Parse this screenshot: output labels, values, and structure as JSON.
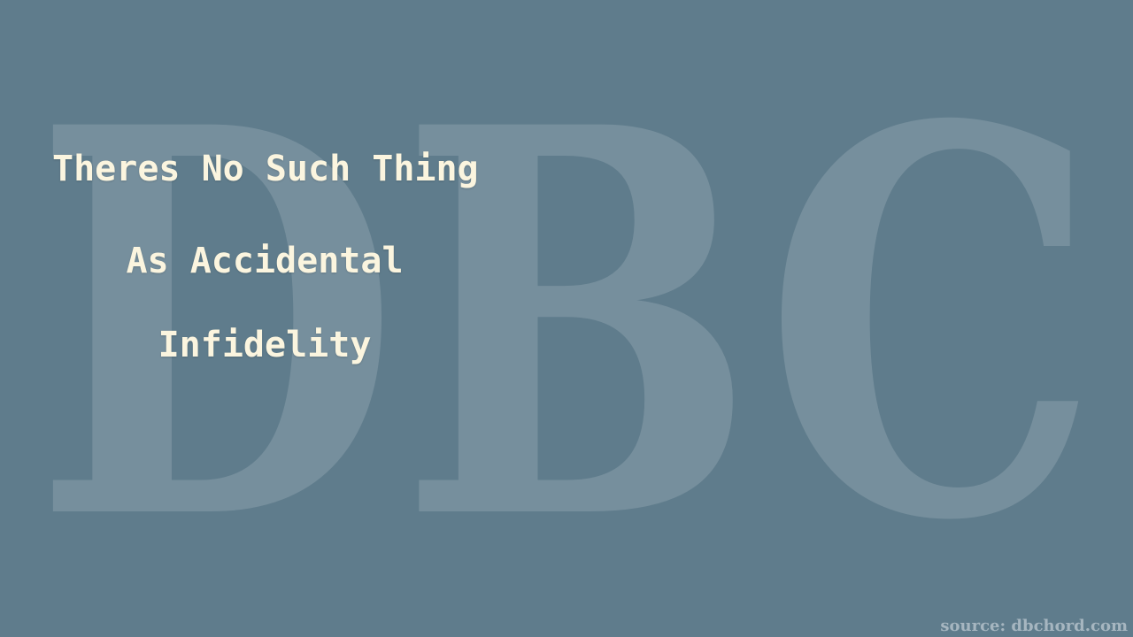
{
  "background_color": "#5f7c8c",
  "watermark": {
    "text": "DBC"
  },
  "title": {
    "lines": [
      "Theres No Such Thing",
      "As Accidental",
      "Infidelity"
    ],
    "color": "#fbf5df"
  },
  "source": {
    "text": "source: dbchord.com"
  }
}
